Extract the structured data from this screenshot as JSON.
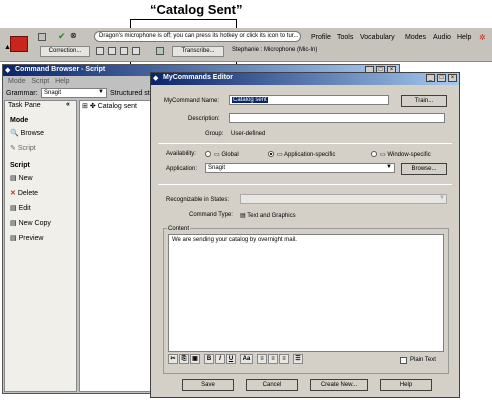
{
  "annotation": "“Catalog Sent”",
  "dragon_bar": {
    "message": "Dragon's microphone is off; you can press its hotkey or click its icon to tur...",
    "menus": [
      "Profile",
      "Tools",
      "Vocabulary",
      "Modes",
      "Audio",
      "Help"
    ],
    "correction": "Correction...",
    "transcribe": "Transcribe...",
    "user": "Stephanie : Microphone (Mic-In)"
  },
  "command_browser": {
    "title": "Command Browser - Script",
    "menus": [
      "Mode",
      "Script",
      "Help"
    ],
    "grammar_label": "Grammar:",
    "grammar_value": "Snagit",
    "structured": "Structured stat",
    "taskpane_title": "Task Pane",
    "mode_heading": "Mode",
    "mode_items": [
      "Browse",
      "Script"
    ],
    "script_heading": "Script",
    "script_items": [
      "New",
      "Delete",
      "Edit",
      "New Copy",
      "Preview"
    ],
    "tree_item": "Catalog sent"
  },
  "editor": {
    "title": "MyCommands Editor",
    "name_label": "MyCommand Name:",
    "name_value": "Catalog sent",
    "train": "Train...",
    "desc_label": "Description:",
    "group_label": "Group:",
    "group_value": "User-defined",
    "availability_label": "Availability:",
    "availability_options": [
      "Global",
      "Application-specific",
      "Window-specific"
    ],
    "application_label": "Application:",
    "application_value": "Snagit",
    "browse": "Browse...",
    "states_label": "Recognizable in States:",
    "type_label": "Command Type:",
    "type_value": "Text and Graphics",
    "content_label": "Content",
    "content_text": "We are sending your catalog by overnight mail.",
    "format_buttons": [
      "B",
      "I",
      "U",
      "Aa"
    ],
    "plain_text": "Plain Text",
    "buttons": [
      "Save",
      "Cancel",
      "Create New...",
      "Help"
    ]
  }
}
